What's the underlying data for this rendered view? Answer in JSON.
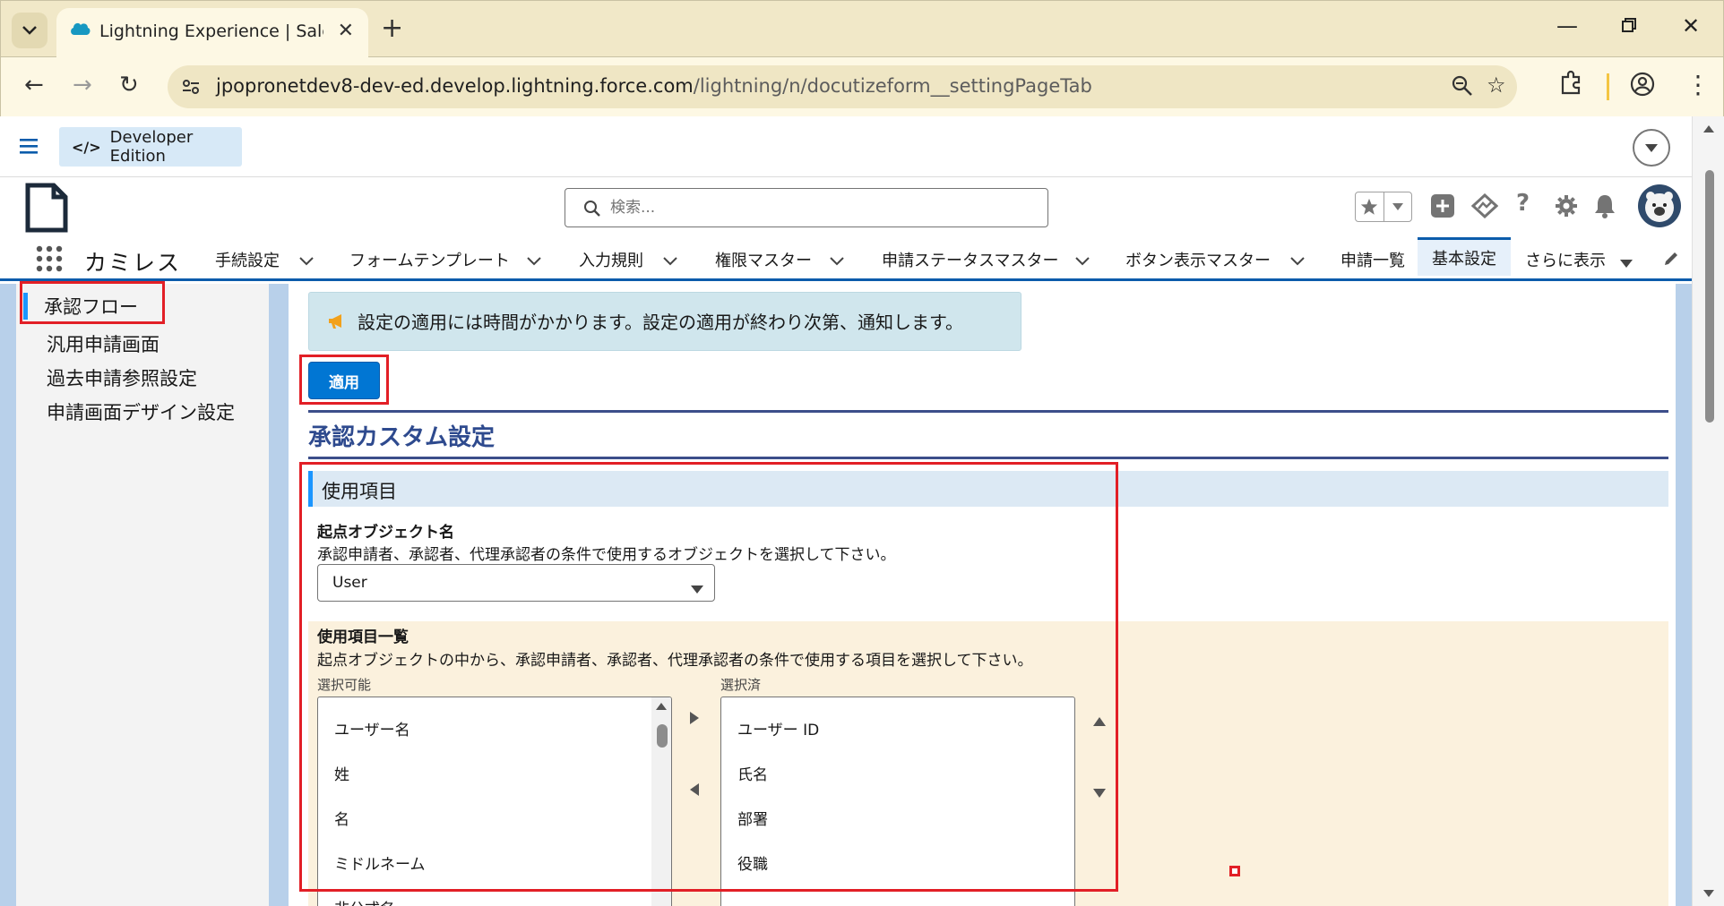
{
  "browser": {
    "tab_title": "Lightning Experience | Salesforce",
    "new_tab_label": "+",
    "url_host": "jpopronetdev8-dev-ed.develop.lightning.force.com",
    "url_path": "/lightning/n/docutizeform__settingPageTab"
  },
  "sf": {
    "dev_badge_code": "</>",
    "dev_badge_label": "Developer Edition",
    "search_placeholder": "検索...",
    "app_name": "カミレス",
    "nav_items": [
      {
        "label": "手続設定",
        "has_menu": true
      },
      {
        "label": "フォームテンプレート",
        "has_menu": true
      },
      {
        "label": "入力規則",
        "has_menu": true
      },
      {
        "label": "権限マスター",
        "has_menu": true
      },
      {
        "label": "申請ステータスマスター",
        "has_menu": true
      },
      {
        "label": "ボタン表示マスター",
        "has_menu": true
      },
      {
        "label": "申請一覧",
        "has_menu": false
      },
      {
        "label": "基本設定",
        "has_menu": false,
        "active": true
      },
      {
        "label": "さらに表示",
        "has_menu": true
      }
    ]
  },
  "side_menu": {
    "items": [
      {
        "label": "承認フロー",
        "active": true
      },
      {
        "label": "汎用申請画面",
        "active": false
      },
      {
        "label": "過去申請参照設定",
        "active": false
      },
      {
        "label": "申請画面デザイン設定",
        "active": false
      }
    ]
  },
  "main": {
    "notice": "設定の適用には時間がかかります。設定の適用が終わり次第、通知します。",
    "apply_button": "適用",
    "section_title": "承認カスタム設定",
    "subsection_title": "使用項目",
    "origin_object": {
      "label": "起点オブジェクト名",
      "help": "承認申請者、承認者、代理承認者の条件で使用するオブジェクトを選択して下さい。",
      "value": "User"
    },
    "fields": {
      "label": "使用項目一覧",
      "help": "起点オブジェクトの中から、承認申請者、承認者、代理承認者の条件で使用する項目を選択して下さい。",
      "available_label": "選択可能",
      "selected_label": "選択済",
      "available": [
        "ユーザー名",
        "姓",
        "名",
        "ミドルネーム",
        "非公式名"
      ],
      "selected": [
        "ユーザー ID",
        "氏名",
        "部署",
        "役職"
      ]
    }
  },
  "colors": {
    "brand_blue": "#0176d3",
    "highlight_red": "#e21f26",
    "section_navy": "#2e4a8e"
  }
}
